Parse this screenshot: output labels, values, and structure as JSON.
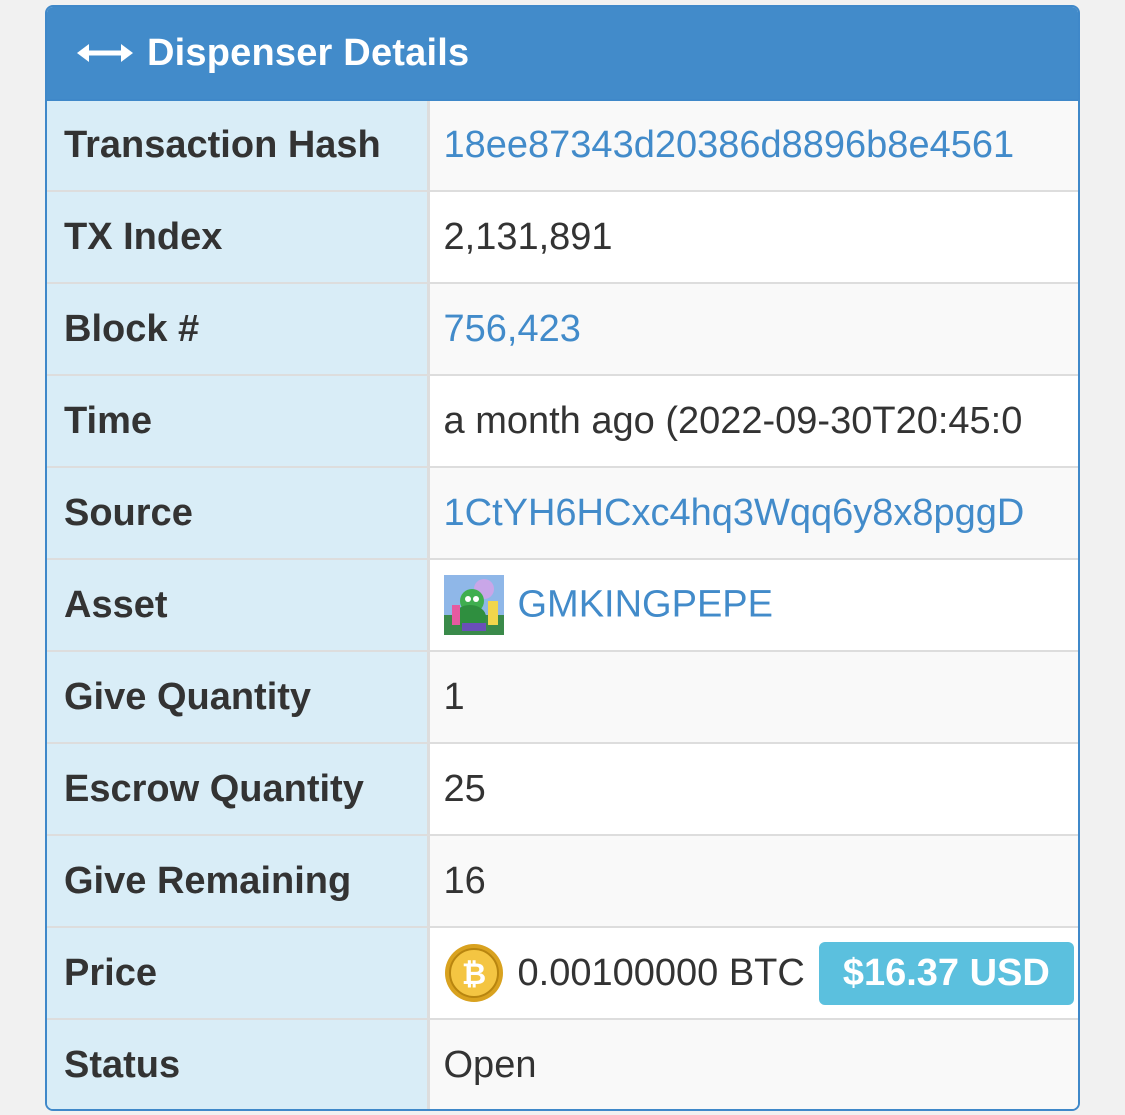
{
  "header": {
    "title": "Dispenser Details",
    "icon": "horizontal-arrows-icon"
  },
  "rows": {
    "tx_hash": {
      "label": "Transaction Hash",
      "value": "18ee87343d20386d8896b8e4561"
    },
    "tx_index": {
      "label": "TX Index",
      "value": "2,131,891"
    },
    "block": {
      "label": "Block #",
      "value": "756,423"
    },
    "time": {
      "label": "Time",
      "value": "a month ago (2022-09-30T20:45:0"
    },
    "source": {
      "label": "Source",
      "value": "1CtYH6HCxc4hq3Wqq6y8x8pggD"
    },
    "asset": {
      "label": "Asset",
      "value": "GMKINGPEPE",
      "icon": "asset-thumbnail-icon"
    },
    "give_quantity": {
      "label": "Give Quantity",
      "value": "1"
    },
    "escrow_quantity": {
      "label": "Escrow Quantity",
      "value": "25"
    },
    "give_remaining": {
      "label": "Give Remaining",
      "value": "16"
    },
    "price": {
      "label": "Price",
      "value": "0.00100000 BTC",
      "usd": "$16.37 USD",
      "icon": "bitcoin-icon"
    },
    "status": {
      "label": "Status",
      "value": "Open"
    }
  },
  "colors": {
    "header_bg": "#428bca",
    "label_bg": "#d9edf7",
    "link": "#428bca",
    "badge": "#5bc0de"
  }
}
